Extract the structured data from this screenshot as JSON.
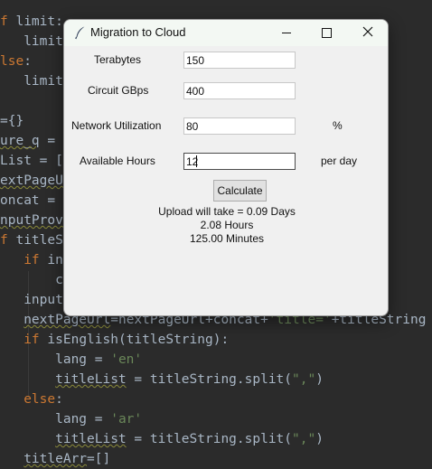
{
  "editor": {
    "lines": [
      "f limit:",
      "   limit=",
      "lse:",
      "   limit=",
      "",
      "={}",
      "ure_q = {",
      "List = []",
      "extPageUr",
      "oncat = '",
      "nputProvi",
      "f titleSt",
      "   if inp",
      "       co",
      "   inputP",
      "   nextPageUrl=nextPageUrl+concat+'title='+titleString",
      "   if isEnglish(titleString):",
      "       lang = 'en'",
      "       titleList = titleString.split(\",\")",
      "   else:",
      "       lang = 'ar'",
      "       titleList = titleString.split(\",\")",
      "   titleArr=[]"
    ]
  },
  "window": {
    "title": "Migration to Cloud",
    "icon": "feather-icon",
    "controls": {
      "minimize": "minimize-icon",
      "maximize": "maximize-icon",
      "close": "close-icon"
    }
  },
  "form": {
    "terabytes": {
      "label": "Terabytes",
      "value": "150"
    },
    "circuit": {
      "label": "Circuit GBps",
      "value": "400"
    },
    "utilization": {
      "label": "Network Utilization",
      "value": "80",
      "unit": "%"
    },
    "hours": {
      "label": "Available Hours",
      "value": "12",
      "unit": "per day"
    },
    "button": "Calculate"
  },
  "result": {
    "days": "Upload will take  = 0.09 Days",
    "hours": "2.08 Hours",
    "minutes": "125.00 Minutes"
  },
  "colors": {
    "editor_bg": "#2b2b2b",
    "keyword": "#cc7832",
    "string": "#6a8759",
    "text": "#a9b7c6",
    "window_bg": "#f0f0f0"
  }
}
